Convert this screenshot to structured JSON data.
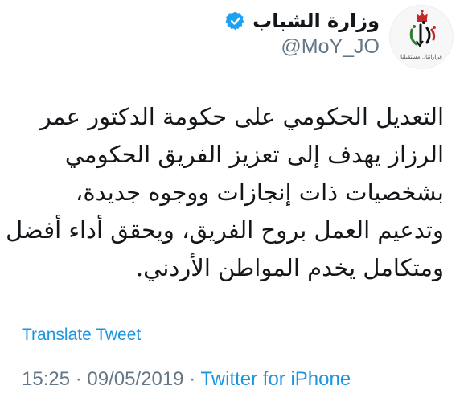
{
  "account": {
    "display_name": "وزارة الشباب",
    "handle": "@MoY_JO",
    "avatar_caption": "قراراتنا.. مستقبلنا",
    "verified_color": "#1da1f2"
  },
  "header": {
    "menu_icon": "chevron-down-icon"
  },
  "tweet": {
    "lines": [
      "التعديل الحكومي على حكومة الدكتور عمر",
      "الرزاز يهدف إلى تعزيز الفريق الحكومي",
      "بشخصيات ذات إنجازات ووجوه جديدة،",
      "وتدعيم العمل بروح الفريق، ويحقق أداء أفضل",
      "ومتكامل يخدم المواطن الأردني."
    ]
  },
  "actions": {
    "translate_label": "Translate Tweet"
  },
  "meta": {
    "time": "15:25",
    "separator": "·",
    "date": "09/05/2019",
    "source": "Twitter for iPhone"
  },
  "colors": {
    "link": "#1b95e0",
    "secondary": "#657786",
    "text": "#14171a"
  }
}
